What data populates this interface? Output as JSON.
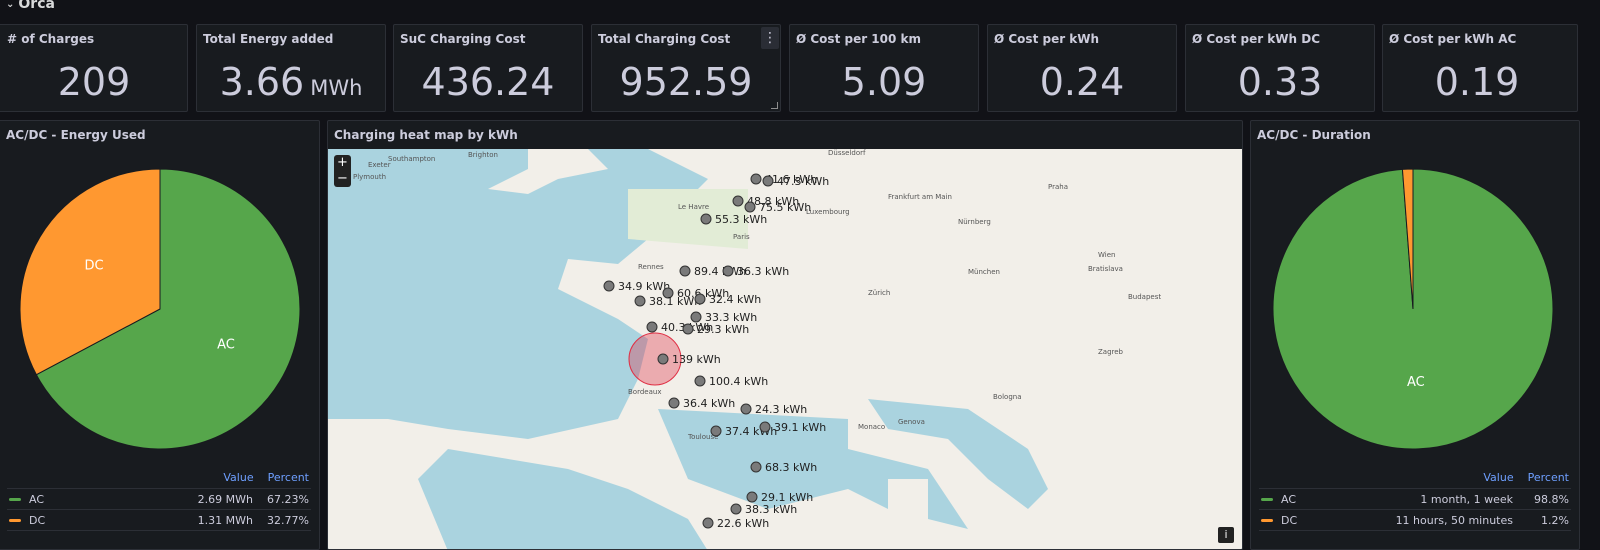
{
  "row": {
    "title": "Orca",
    "chevron": "chevron-down-icon"
  },
  "stats": [
    {
      "title": "# of Charges",
      "value": "209",
      "unit": ""
    },
    {
      "title": "Total Energy added",
      "value": "3.66",
      "unit": "MWh"
    },
    {
      "title": "SuC Charging Cost",
      "value": "436.24",
      "unit": ""
    },
    {
      "title": "Total Charging Cost",
      "value": "952.59",
      "unit": ""
    },
    {
      "title": "Ø Cost per 100 km",
      "value": "5.09",
      "unit": ""
    },
    {
      "title": "Ø Cost per kWh",
      "value": "0.24",
      "unit": ""
    },
    {
      "title": "Ø Cost per kWh DC",
      "value": "0.33",
      "unit": ""
    },
    {
      "title": "Ø Cost per kWh AC",
      "value": "0.19",
      "unit": ""
    }
  ],
  "menu_icon": "⋮",
  "colors": {
    "ac": "#56a64b",
    "dc": "#ff9830",
    "bubble": "#e02f44",
    "map_sea": "#aad3df",
    "map_land": "#f2efe9"
  },
  "energy_panel": {
    "title": "AC/DC - Energy Used",
    "legend_header": {
      "value": "Value",
      "percent": "Percent"
    },
    "slices": [
      {
        "name": "AC",
        "value": "2.69 MWh",
        "percent": "67.23%",
        "fraction": 0.6723
      },
      {
        "name": "DC",
        "value": "1.31 MWh",
        "percent": "32.77%",
        "fraction": 0.3277
      }
    ]
  },
  "duration_panel": {
    "title": "AC/DC - Duration",
    "legend_header": {
      "value": "Value",
      "percent": "Percent"
    },
    "slices": [
      {
        "name": "AC",
        "value": "1 month, 1 week",
        "percent": "98.8%",
        "fraction": 0.988
      },
      {
        "name": "DC",
        "value": "11 hours, 50 minutes",
        "percent": "1.2%",
        "fraction": 0.012
      }
    ]
  },
  "map_panel": {
    "title": "Charging heat map by kWh",
    "zoom_in": "+",
    "zoom_out": "−",
    "info": "i",
    "markers": [
      "41.6 kWh",
      "47.3 kWh",
      "48.8 kWh",
      "75.5 kWh",
      "55.3 kWh",
      "89.4 kWh",
      "36.3 kWh",
      "34.9 kWh",
      "60.6 kWh",
      "38.1 kWh",
      "32.4 kWh",
      "33.3 kWh",
      "40.3 kWh",
      "29.3 kWh",
      "139 kWh",
      "100.4 kWh",
      "36.4 kWh",
      "24.3 kWh",
      "37.4 kWh",
      "39.1 kWh",
      "68.3 kWh",
      "29.1 kWh",
      "38.3 kWh",
      "22.6 kWh"
    ],
    "places": [
      "Düsseldorf",
      "Southampton",
      "Brighton",
      "Exeter",
      "Plymouth",
      "Le Havre",
      "Paris",
      "Rennes",
      "Frankfurt am Main",
      "Nürnberg",
      "Praha",
      "München",
      "Bordeaux",
      "Toulouse",
      "Genova",
      "Bologna",
      "Monaco",
      "Zagreb",
      "Budapest",
      "Bratislava",
      "Wien",
      "Luxembourg",
      "Zürich"
    ]
  }
}
